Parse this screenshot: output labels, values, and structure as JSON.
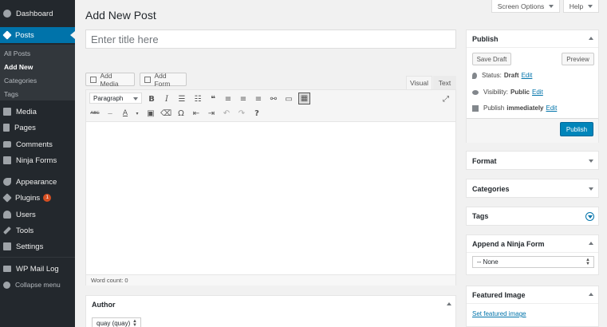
{
  "sidebar": {
    "dashboard": "Dashboard",
    "posts": "Posts",
    "submenu": [
      "All Posts",
      "Add New",
      "Categories",
      "Tags"
    ],
    "media": "Media",
    "pages": "Pages",
    "comments": "Comments",
    "ninja_forms": "Ninja Forms",
    "appearance": "Appearance",
    "plugins": "Plugins",
    "plugins_badge": "1",
    "users": "Users",
    "tools": "Tools",
    "settings": "Settings",
    "wp_mail_log": "WP Mail Log",
    "collapse": "Collapse menu"
  },
  "header": {
    "title": "Add New Post",
    "screen_options": "Screen Options",
    "help": "Help"
  },
  "editor": {
    "title_placeholder": "Enter title here",
    "add_media": "Add Media",
    "add_form": "Add Form",
    "tab_visual": "Visual",
    "tab_text": "Text",
    "format": "Paragraph",
    "word_count": "Word count: 0"
  },
  "author_box": {
    "title": "Author",
    "value": "quay (quay)"
  },
  "publish": {
    "title": "Publish",
    "save_draft": "Save Draft",
    "preview": "Preview",
    "status_label": "Status:",
    "status_value": "Draft",
    "visibility_label": "Visibility:",
    "visibility_value": "Public",
    "publish_label": "Publish",
    "publish_value": "immediately",
    "edit": "Edit",
    "publish_button": "Publish"
  },
  "boxes": {
    "format": "Format",
    "categories": "Categories",
    "tags": "Tags",
    "ninja": "Append a Ninja Form",
    "ninja_select": "-- None",
    "featured": "Featured Image",
    "featured_link": "Set featured image"
  },
  "colors": {
    "sidebar_bg": "#23282d",
    "active": "#0073aa",
    "publish_btn": "#0085ba",
    "badge": "#d54e21"
  }
}
